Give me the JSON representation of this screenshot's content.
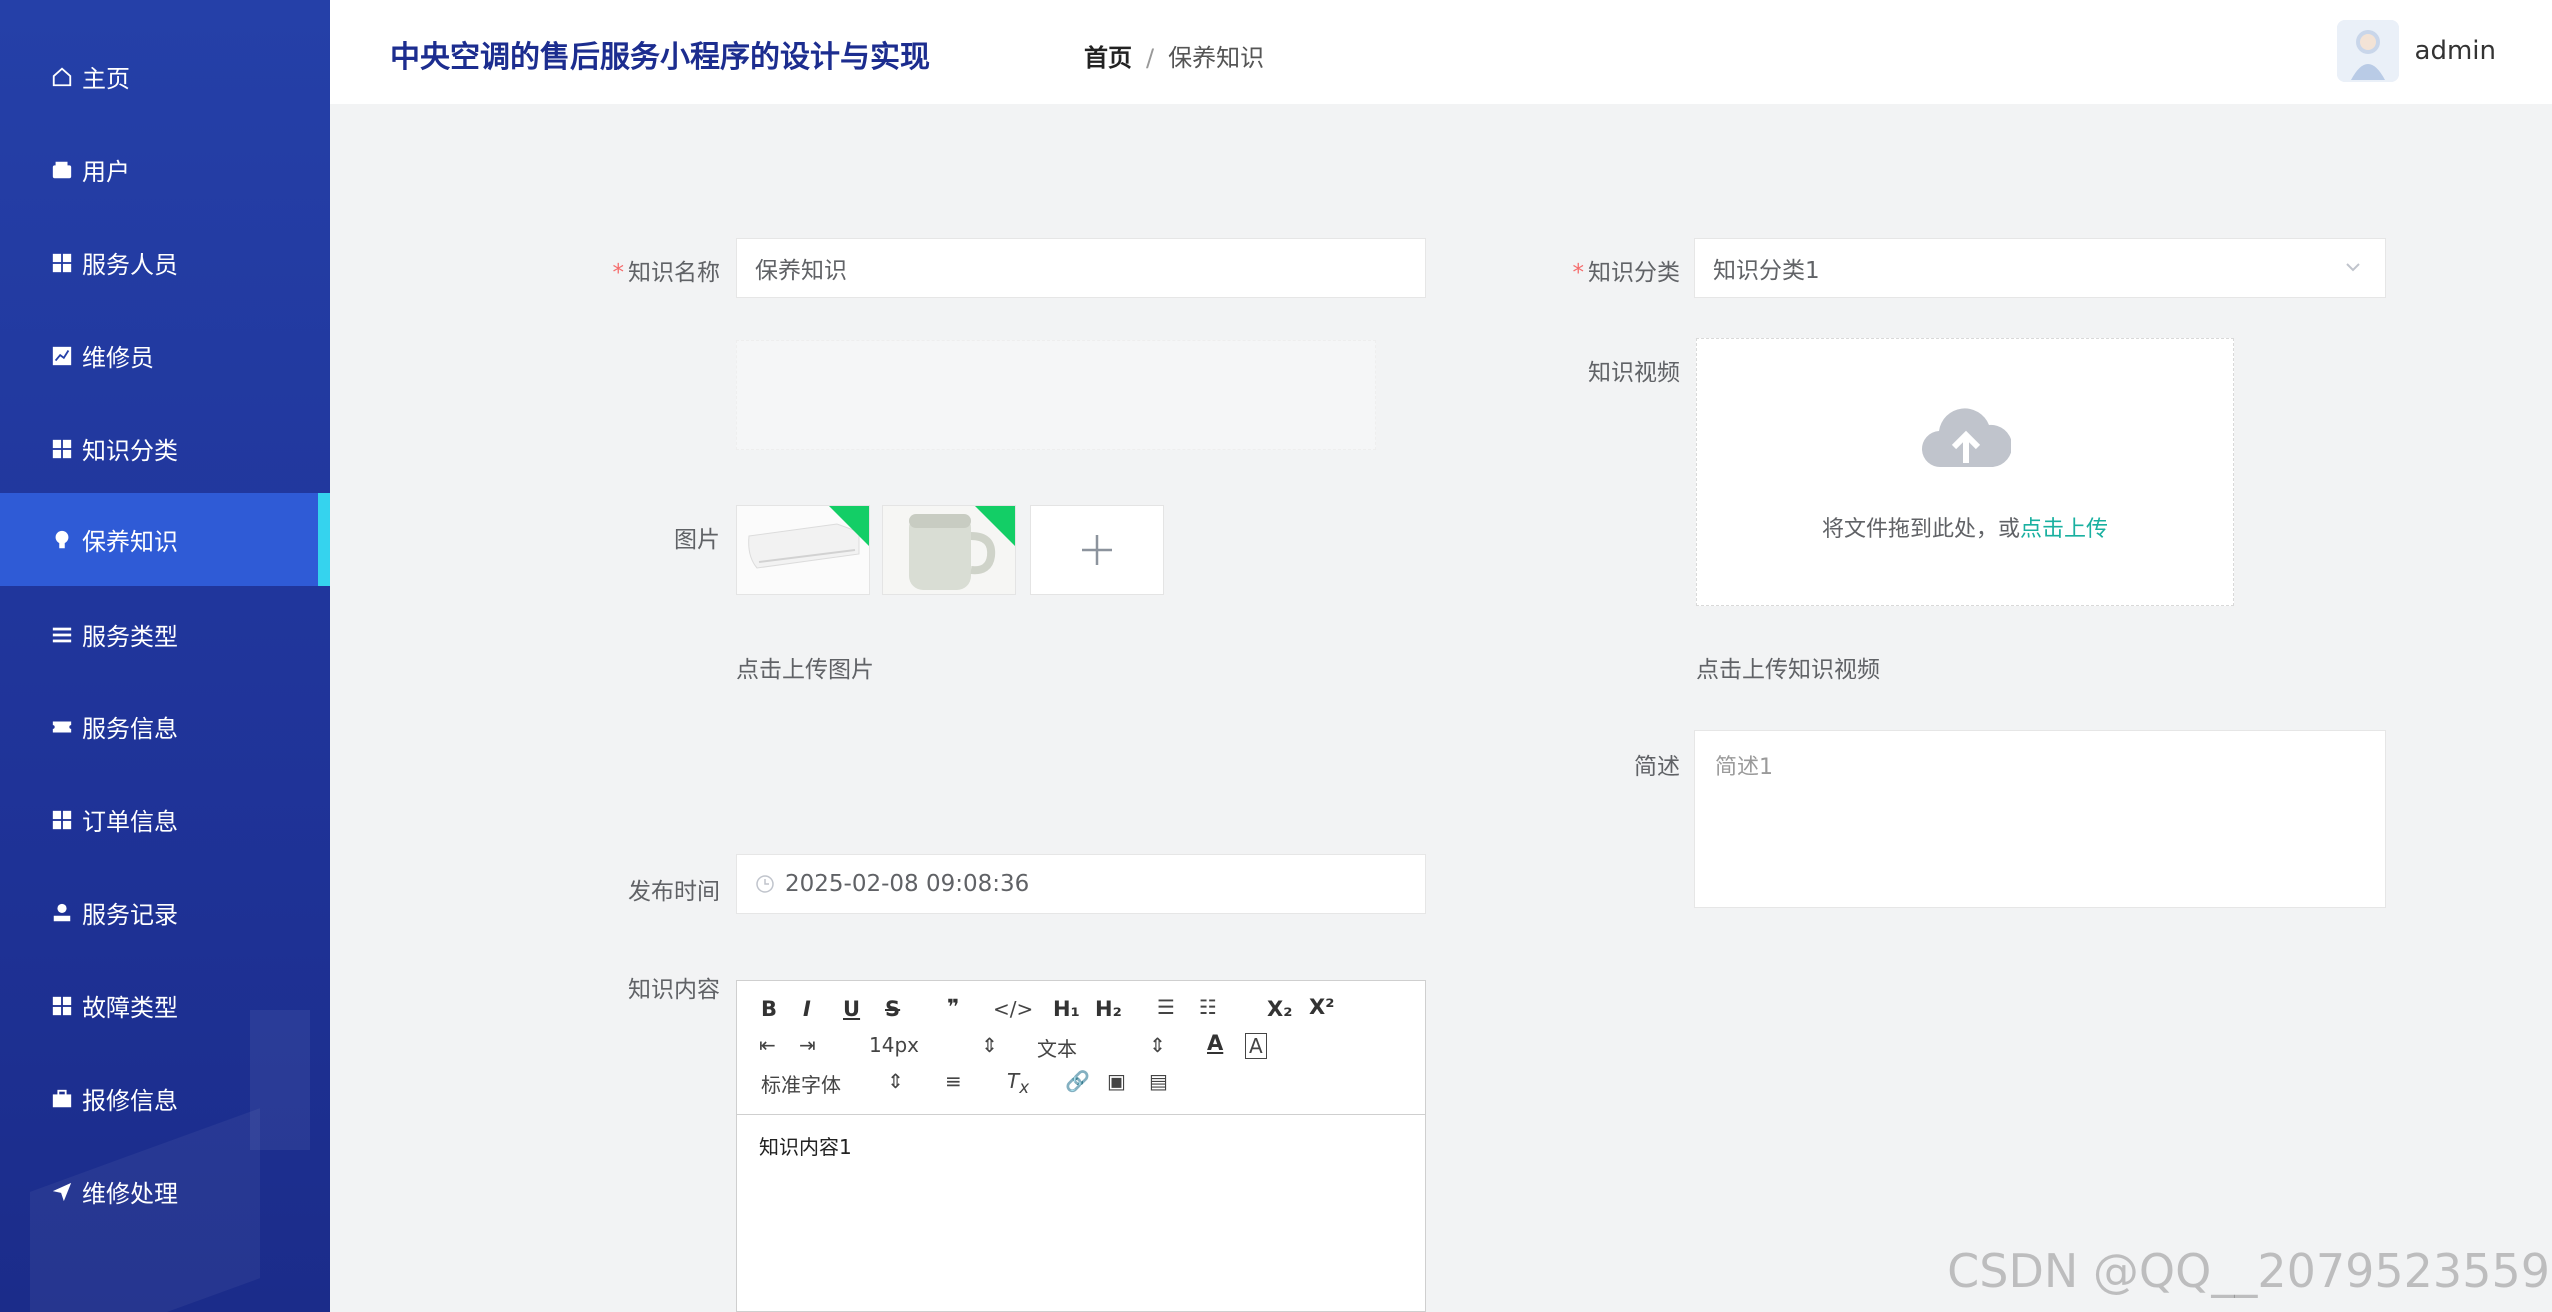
{
  "sidebar": {
    "items": [
      {
        "label": "主页",
        "icon": "home-icon"
      },
      {
        "label": "用户",
        "icon": "wallet-icon"
      },
      {
        "label": "服务人员",
        "icon": "grid-icon"
      },
      {
        "label": "维修员",
        "icon": "chart-icon"
      },
      {
        "label": "知识分类",
        "icon": "grid-icon"
      },
      {
        "label": "保养知识",
        "icon": "bulb-icon",
        "active": true
      },
      {
        "label": "服务类型",
        "icon": "list-icon"
      },
      {
        "label": "服务信息",
        "icon": "ticket-icon"
      },
      {
        "label": "订单信息",
        "icon": "grid-icon"
      },
      {
        "label": "服务记录",
        "icon": "user-icon"
      },
      {
        "label": "故障类型",
        "icon": "grid-icon"
      },
      {
        "label": "报修信息",
        "icon": "briefcase-icon"
      },
      {
        "label": "维修处理",
        "icon": "send-icon"
      }
    ]
  },
  "header": {
    "title": "中央空调的售后服务小程序的设计与实现",
    "breadcrumb": {
      "home": "首页",
      "separator": "/",
      "current": "保养知识"
    },
    "username": "admin"
  },
  "form": {
    "name_label": "知识名称",
    "name_value": "保养知识",
    "category_label": "知识分类",
    "category_value": "知识分类1",
    "image_label": "图片",
    "image_hint": "点击上传图片",
    "video_label": "知识视频",
    "video_drop_text": "将文件拖到此处，或",
    "video_drop_link": "点击上传",
    "video_hint": "点击上传知识视频",
    "summary_label": "简述",
    "summary_value": "简述1",
    "time_label": "发布时间",
    "time_value": "2025-02-08 09:08:36",
    "content_label": "知识内容",
    "content_value": "知识内容1"
  },
  "editor": {
    "font_size": "14px",
    "text_style": "文本",
    "font_family": "标准字体"
  },
  "watermark": "CSDN @QQ__2079523559",
  "colors": {
    "sidebar": "#2540a8",
    "active_item": "#2f5bd6",
    "active_bar": "#35d3ee",
    "title": "#1c2d8f",
    "link": "#19b0a0",
    "required": "#f56c6c"
  }
}
